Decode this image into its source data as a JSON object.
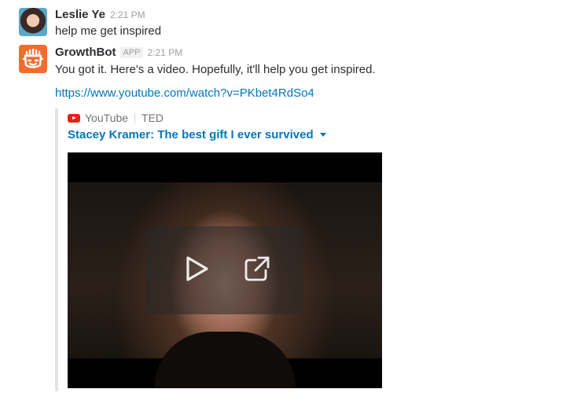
{
  "messages": [
    {
      "sender": "Leslie Ye",
      "timestamp": "2:21 PM",
      "text": "help me get inspired",
      "avatar_icon": "user-avatar"
    },
    {
      "sender": "GrowthBot",
      "badge": "APP",
      "timestamp": "2:21 PM",
      "text": "You got it. Here's a video. Hopefully, it'll help you get inspired.",
      "link": "https://www.youtube.com/watch?v=PKbet4RdSo4",
      "avatar_icon": "growthbot-avatar",
      "attachment": {
        "service_name": "YouTube",
        "author": "TED",
        "title": "Stacey Kramer: The best gift I ever survived",
        "service_icon": "youtube-icon",
        "controls": [
          "play-icon",
          "open-external-icon"
        ]
      }
    }
  ],
  "colors": {
    "link": "#0576b9",
    "text": "#2c2d30",
    "muted": "#9e9ea6",
    "bot_avatar": "#f26c2d",
    "youtube_red": "#e62117"
  }
}
